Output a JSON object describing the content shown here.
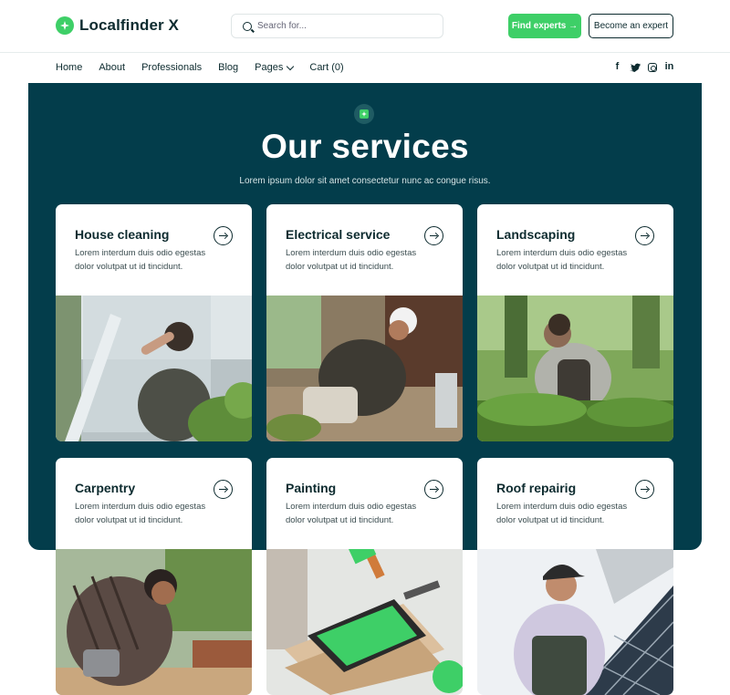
{
  "brand": {
    "name": "Localfinder X"
  },
  "search": {
    "placeholder": "Search for..."
  },
  "header": {
    "find_experts": "Find experts →",
    "become_expert": "Become an expert"
  },
  "nav": {
    "items": [
      {
        "label": "Home"
      },
      {
        "label": "About"
      },
      {
        "label": "Professionals"
      },
      {
        "label": "Blog"
      },
      {
        "label": "Pages"
      },
      {
        "label": "Cart (0)"
      }
    ],
    "social": [
      "facebook-icon",
      "twitter-icon",
      "instagram-icon",
      "linkedin-icon"
    ]
  },
  "hero": {
    "title": "Our services",
    "subtitle": "Lorem ipsum dolor sit amet consectetur nunc ac congue risus."
  },
  "services": [
    {
      "title": "House cleaning",
      "desc": "Lorem interdum duis odio egestas dolor volutpat ut id tincidunt."
    },
    {
      "title": "Electrical service",
      "desc": "Lorem interdum duis odio egestas dolor volutpat ut id tincidunt."
    },
    {
      "title": "Landscaping",
      "desc": "Lorem interdum duis odio egestas dolor volutpat ut id tincidunt."
    },
    {
      "title": "Carpentry",
      "desc": "Lorem interdum duis odio egestas dolor volutpat ut id tincidunt."
    },
    {
      "title": "Painting",
      "desc": "Lorem interdum duis odio egestas dolor volutpat ut id tincidunt."
    },
    {
      "title": "Roof repairig",
      "desc": "Lorem interdum duis odio egestas dolor volutpat ut id tincidunt."
    }
  ],
  "colors": {
    "brand_green": "#3ecf67",
    "hero_bg": "#033d4b",
    "text_dark": "#0d2b2f"
  }
}
